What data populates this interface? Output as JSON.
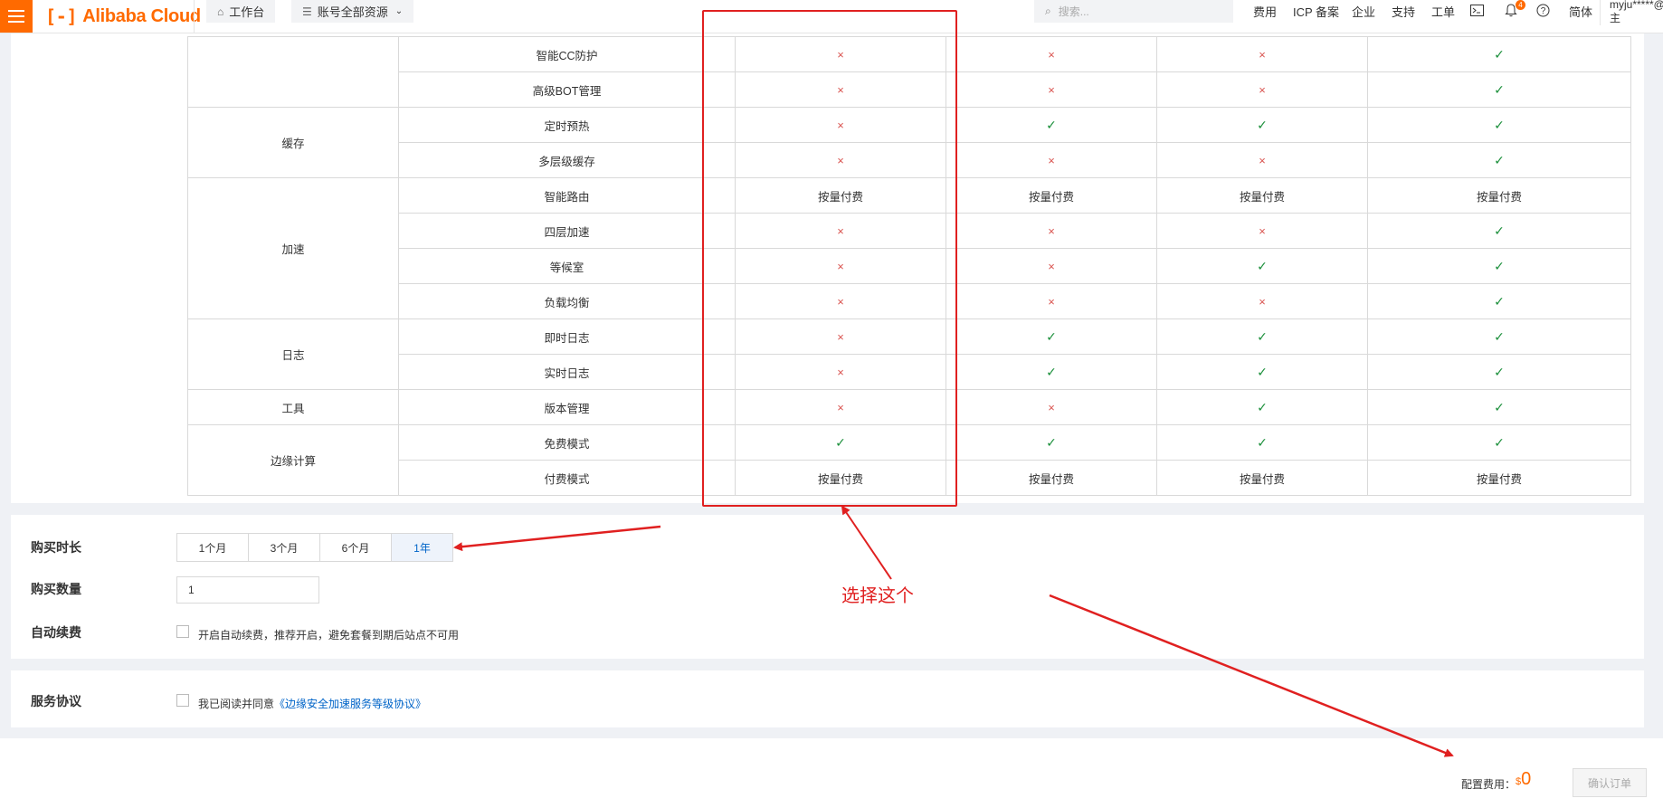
{
  "topbar": {
    "brand": "Alibaba Cloud",
    "workbench": "工作台",
    "resources": "账号全部资源",
    "search_placeholder": "搜索...",
    "nav": [
      "费用",
      "ICP 备案",
      "企业",
      "支持",
      "工单"
    ],
    "notification_count": "4",
    "language": "简体",
    "user": "myju*****@",
    "user_sub": "主"
  },
  "table": {
    "rows": [
      {
        "group": "",
        "feature": "智能CC防护",
        "values": [
          "x",
          "x",
          "x",
          "ok"
        ]
      },
      {
        "group": "",
        "feature": "高级BOT管理",
        "values": [
          "x",
          "x",
          "x",
          "ok"
        ]
      },
      {
        "group": "缓存",
        "feature": "定时预热",
        "values": [
          "x",
          "ok",
          "ok",
          "ok"
        ]
      },
      {
        "group": "",
        "feature": "多层级缓存",
        "values": [
          "x",
          "x",
          "x",
          "ok"
        ]
      },
      {
        "group": "加速",
        "feature": "智能路由",
        "values": [
          "按量付费",
          "按量付费",
          "按量付费",
          "按量付费"
        ]
      },
      {
        "group": "",
        "feature": "四层加速",
        "values": [
          "x",
          "x",
          "x",
          "ok"
        ]
      },
      {
        "group": "",
        "feature": "等候室",
        "values": [
          "x",
          "x",
          "ok",
          "ok"
        ]
      },
      {
        "group": "",
        "feature": "负载均衡",
        "values": [
          "x",
          "x",
          "x",
          "ok"
        ]
      },
      {
        "group": "日志",
        "feature": "即时日志",
        "values": [
          "x",
          "ok",
          "ok",
          "ok"
        ]
      },
      {
        "group": "",
        "feature": "实时日志",
        "values": [
          "x",
          "ok",
          "ok",
          "ok"
        ]
      },
      {
        "group": "工具",
        "feature": "版本管理",
        "values": [
          "x",
          "x",
          "ok",
          "ok"
        ]
      },
      {
        "group": "边缘计算",
        "feature": "免费模式",
        "values": [
          "ok",
          "ok",
          "ok",
          "ok"
        ]
      },
      {
        "group": "",
        "feature": "付费模式",
        "values": [
          "按量付费",
          "按量付费",
          "按量付费",
          "按量付费"
        ]
      }
    ]
  },
  "purchase": {
    "duration_label": "购买时长",
    "durations": [
      "1个月",
      "3个月",
      "6个月",
      "1年"
    ],
    "selected_duration": "1年",
    "quantity_label": "购买数量",
    "quantity_value": "1",
    "autorenew_label": "自动续费",
    "autorenew_text": "开启自动续费，推荐开启，避免套餐到期后站点不可用"
  },
  "agreement": {
    "label": "服务协议",
    "text": "我已阅读并同意",
    "link": "《边缘安全加速服务等级协议》"
  },
  "footer": {
    "fee_label": "配置费用：",
    "currency": "$",
    "fee_value": "0",
    "confirm_label": "确认订单"
  },
  "annotation": {
    "note": "选择这个"
  },
  "colors": {
    "brand": "#ff6a00",
    "check": "#1a8f3a",
    "cross": "#d9534f",
    "annotation": "#e02020",
    "link": "#0064c8"
  }
}
